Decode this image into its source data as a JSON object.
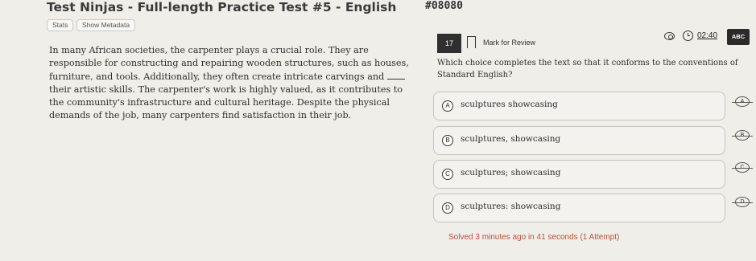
{
  "header": {
    "title": "Test Ninjas - Full-length Practice Test #5 - English",
    "code": "#08080",
    "buttons": {
      "stats": "Stats",
      "show_metadata": "Show Metadata"
    }
  },
  "passage": {
    "before_blank": "In many African societies, the carpenter plays a crucial role. They are responsible for constructing and repairing wooden structures, such as houses, furniture, and tools. Additionally, they often create intricate carvings and ",
    "after_blank": " their artistic skills. The carpenter's work is highly valued, as it contributes to the community's infrastructure and cultural heritage. Despite the physical demands of the job, many carpenters find satisfaction in their job."
  },
  "question_bar": {
    "number": "17",
    "mark_for_review": "Mark for Review",
    "timer": "02:40",
    "abc_label": "ABC"
  },
  "question": {
    "stem": "Which choice completes the text so that it conforms to the conventions of Standard English?",
    "choices": [
      {
        "letter": "A",
        "text": "sculptures showcasing"
      },
      {
        "letter": "B",
        "text": "sculptures, showcasing"
      },
      {
        "letter": "C",
        "text": "sculptures; showcasing"
      },
      {
        "letter": "D",
        "text": "sculptures: showcasing"
      }
    ]
  },
  "status": {
    "solved": "Solved 3 minutes ago in 41 seconds (1 Attempt)"
  }
}
